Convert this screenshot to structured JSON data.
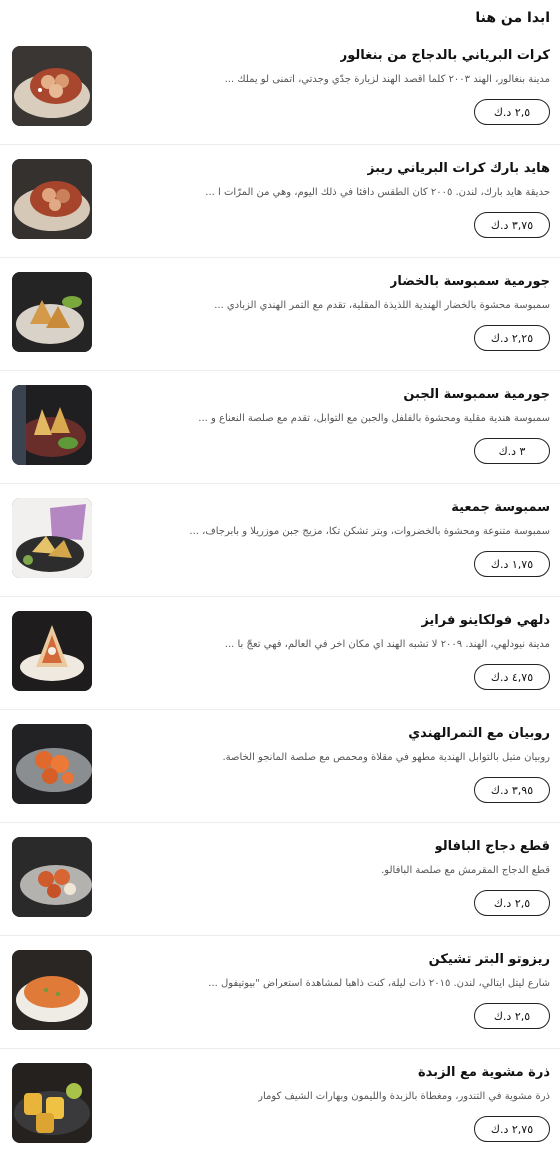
{
  "section": {
    "title": "ابدا من هنا"
  },
  "items": [
    {
      "name": "كرات البرياني بالدجاج من بنغالور",
      "desc": "مدينة بنغالور، الهند ٢٠٠٣ كلّما أقصد الهند لزيارة جدّي وجدتي، أتمنى لو يملك ...",
      "price": "٢,٥ د.ك",
      "icon": "biryani-balls-icon"
    },
    {
      "name": "هايد بارك كرات البرياني ريبز",
      "desc": "حديقة هايد بارك، لندن. ٢٠٠٥ كان الطقس دافئاً في ذلك اليوم، وهي من المرّات ا ...",
      "price": "٣,٧٥ د.ك",
      "icon": "biryani-ribs-icon"
    },
    {
      "name": "جورمية سمبوسة بالخضار",
      "desc": "سمبوسة محشوة بالخضار الهندية اللذيذة المقلية، تقدم مع التمر الهندي الزبادي ...",
      "price": "٢,٢٥ د.ك",
      "icon": "vegetable-samosa-icon"
    },
    {
      "name": "جورمية سمبوسة الجبن",
      "desc": "سمبوسة هندية مقلية ومحشوة بالفلفل والجبن مع التوابل، تقدم مع صلصة النعناع و ...",
      "price": "٣ د.ك",
      "icon": "cheese-samosa-icon"
    },
    {
      "name": "سمبوسة جمعية",
      "desc": "سمبوسة متنوعة ومحشوة بالخضروات، وبتر تشكن تكا، مزيج جبن موزريلا و بابرجاف، ...",
      "price": "١,٧٥ د.ك",
      "icon": "assorted-samosa-icon"
    },
    {
      "name": "دلهي فولكاينو فرايز",
      "desc": "مدينة نيودلهي، الهند. ٢٠٠٩ لا تشبه الهند أي مكان آخر في العالم، فهي تعجّ با ...",
      "price": "٤,٧٥ د.ك",
      "icon": "volcano-fries-icon"
    },
    {
      "name": "روبيان مع التمرالهندي",
      "desc": "روبيان متبل بالتوابل الهندية مطهو في مقلاة ومحمص مع صلصة المانجو الخاصة.",
      "price": "٣,٩٥ د.ك",
      "icon": "tamarind-shrimp-icon"
    },
    {
      "name": "قطع دجاج البافالو",
      "desc": "قطع الدجاج المقرمش مع صلصة البافالو.",
      "price": "٢,٥ د.ك",
      "icon": "buffalo-chicken-icon"
    },
    {
      "name": "ريزوتو البتر تشيكن",
      "desc": "شارع ليتل ايتالي، لندن. ٢٠١٥ ذات ليلة، كنت ذاهباً لمشاهدة استعراض \"بيوتيفول ...",
      "price": "٢,٥ د.ك",
      "icon": "butter-chicken-risotto-icon"
    },
    {
      "name": "ذرة مشوية مع الزبدة",
      "desc": "ذرة مشوية في التندور، ومغطاة بالزبدة والليمون وبهارات الشيف كومار",
      "price": "٢,٧٥ د.ك",
      "icon": "grilled-corn-icon"
    }
  ]
}
